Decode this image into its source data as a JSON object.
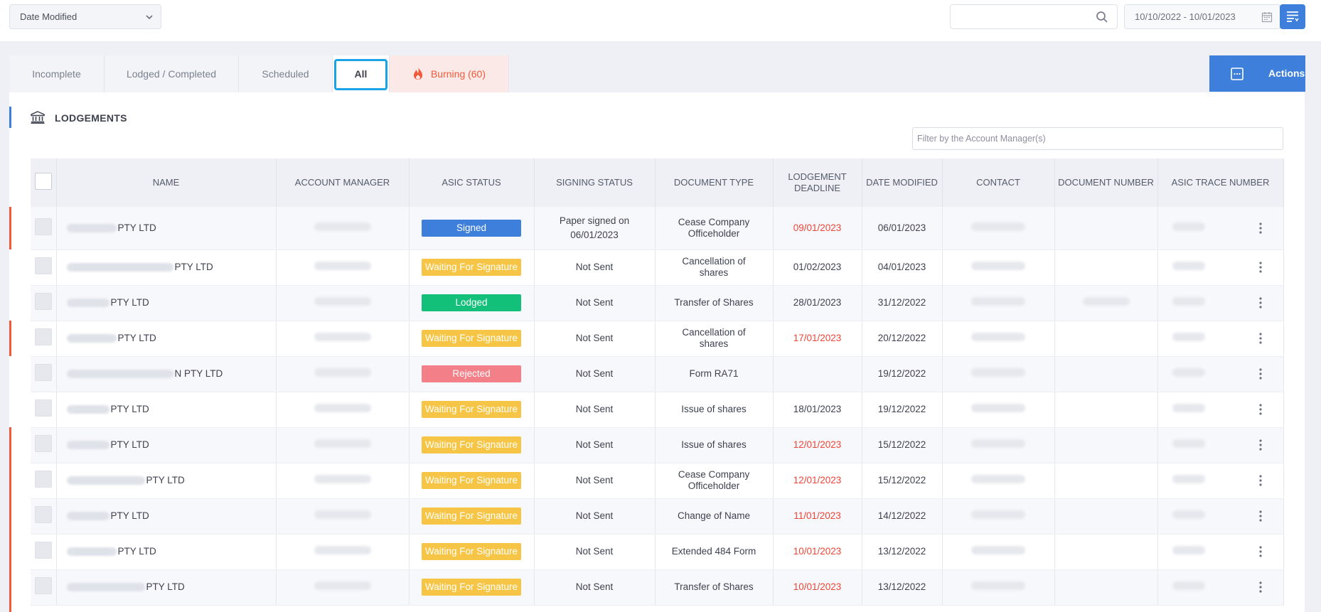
{
  "toolbar": {
    "sort_value": "Date Modified",
    "search_placeholder": "",
    "date_range": "10/10/2022  -  10/01/2023"
  },
  "tabs": [
    {
      "label": "Incomplete"
    },
    {
      "label": "Lodged / Completed"
    },
    {
      "label": "Scheduled"
    },
    {
      "label": "All"
    },
    {
      "label": "Burning (60)"
    }
  ],
  "actions_label": "Actions",
  "section_title": "LODGEMENTS",
  "account_manager_filter_placeholder": "Filter by the Account Manager(s)",
  "columns": [
    "NAME",
    "ACCOUNT MANAGER",
    "ASIC STATUS",
    "SIGNING STATUS",
    "DOCUMENT TYPE",
    "LODGEMENT DEADLINE",
    "DATE MODIFIED",
    "CONTACT",
    "DOCUMENT NUMBER",
    "ASIC TRACE NUMBER"
  ],
  "rows": [
    {
      "name_suffix": "PTY LTD",
      "asic_status": "Signed",
      "signing_status": "Paper signed on 06/01/2023",
      "document_type": "Cease Company Officeholder",
      "deadline": "09/01/2023",
      "deadline_overdue": true,
      "date_modified": "06/01/2023"
    },
    {
      "name_suffix": "PTY LTD",
      "asic_status": "Waiting For Signature",
      "signing_status": "Not Sent",
      "document_type": "Cancellation of shares",
      "deadline": "01/02/2023",
      "deadline_overdue": false,
      "date_modified": "04/01/2023"
    },
    {
      "name_suffix": "PTY LTD",
      "asic_status": "Lodged",
      "signing_status": "Not Sent",
      "document_type": "Transfer of Shares",
      "deadline": "28/01/2023",
      "deadline_overdue": false,
      "date_modified": "31/12/2022"
    },
    {
      "name_suffix": "PTY LTD",
      "asic_status": "Waiting For Signature",
      "signing_status": "Not Sent",
      "document_type": "Cancellation of shares",
      "deadline": "17/01/2023",
      "deadline_overdue": true,
      "date_modified": "20/12/2022"
    },
    {
      "name_suffix": "N PTY LTD",
      "asic_status": "Rejected",
      "signing_status": "Not Sent",
      "document_type": "Form RA71",
      "deadline": "",
      "deadline_overdue": false,
      "date_modified": "19/12/2022"
    },
    {
      "name_suffix": "PTY LTD",
      "asic_status": "Waiting For Signature",
      "signing_status": "Not Sent",
      "document_type": "Issue of shares",
      "deadline": "18/01/2023",
      "deadline_overdue": false,
      "date_modified": "19/12/2022"
    },
    {
      "name_suffix": "PTY LTD",
      "asic_status": "Waiting For Signature",
      "signing_status": "Not Sent",
      "document_type": "Issue of shares",
      "deadline": "12/01/2023",
      "deadline_overdue": true,
      "date_modified": "15/12/2022"
    },
    {
      "name_suffix": "PTY LTD",
      "asic_status": "Waiting For Signature",
      "signing_status": "Not Sent",
      "document_type": "Cease Company Officeholder",
      "deadline": "12/01/2023",
      "deadline_overdue": true,
      "date_modified": "15/12/2022"
    },
    {
      "name_suffix": "PTY LTD",
      "asic_status": "Waiting For Signature",
      "signing_status": "Not Sent",
      "document_type": "Change of Name",
      "deadline": "11/01/2023",
      "deadline_overdue": true,
      "date_modified": "14/12/2022"
    },
    {
      "name_suffix": "PTY LTD",
      "asic_status": "Waiting For Signature",
      "signing_status": "Not Sent",
      "document_type": "Extended 484 Form",
      "deadline": "10/01/2023",
      "deadline_overdue": true,
      "date_modified": "13/12/2022"
    },
    {
      "name_suffix": "PTY LTD",
      "asic_status": "Waiting For Signature",
      "signing_status": "Not Sent",
      "document_type": "Transfer of Shares",
      "deadline": "10/01/2023",
      "deadline_overdue": true,
      "date_modified": "13/12/2022"
    }
  ],
  "colors": {
    "primary": "#3d7fdb",
    "signed": "#3d7fdb",
    "waiting": "#f6c545",
    "lodged": "#12c07a",
    "rejected": "#f37f88",
    "overdue": "#ef4536",
    "burning": "#ef5a3a"
  }
}
